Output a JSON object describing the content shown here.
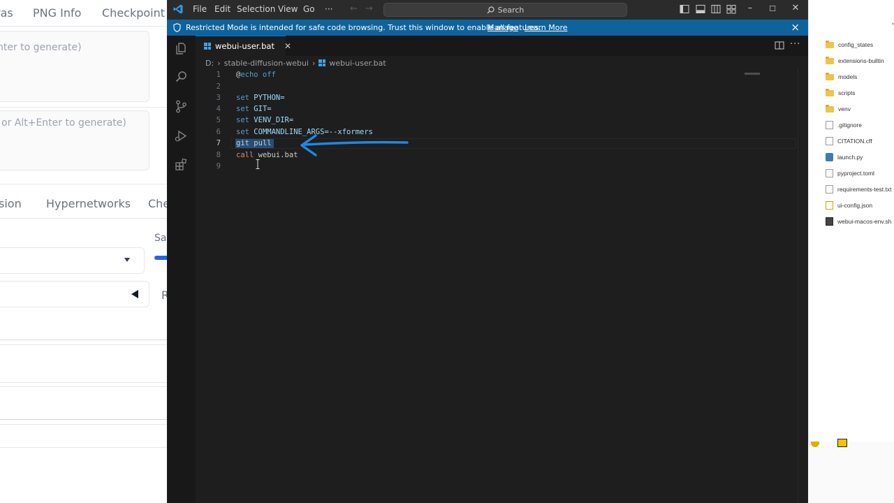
{
  "web_ui": {
    "tabs": [
      "ras",
      "PNG Info",
      "Checkpoint M"
    ],
    "prompt_placeholder": "nter to generate)",
    "negative_placeholder": "or Alt+Enter to generate)",
    "subtabs": [
      "sion",
      "Hypernetworks",
      "Che"
    ],
    "sa_label": "Sa",
    "r_label": "R"
  },
  "explorer": {
    "items": [
      {
        "name": "config_states",
        "icon": "folder"
      },
      {
        "name": "extensions-builtin",
        "icon": "folder"
      },
      {
        "name": "models",
        "icon": "folder"
      },
      {
        "name": "scripts",
        "icon": "folder"
      },
      {
        "name": "venv",
        "icon": "folder"
      },
      {
        "name": ".gitignore",
        "icon": "file"
      },
      {
        "name": "CITATION.cff",
        "icon": "cff"
      },
      {
        "name": "launch.py",
        "icon": "py"
      },
      {
        "name": "pyproject.toml",
        "icon": "file"
      },
      {
        "name": "requirements-test.txt",
        "icon": "file"
      },
      {
        "name": "ui-config.json",
        "icon": "json"
      },
      {
        "name": "webui-macos-env.sh",
        "icon": "sh"
      }
    ]
  },
  "vscode": {
    "menu": [
      "File",
      "Edit",
      "Selection",
      "View",
      "Go",
      "···"
    ],
    "search_label": "Search",
    "banner": {
      "text": "Restricted Mode is intended for safe code browsing. Trust this window to enable all features.",
      "manage": "Manage",
      "learn_more": "Learn More"
    },
    "tab": {
      "filename": "webui-user.bat",
      "close": "✕"
    },
    "breadcrumb": [
      "D:",
      "stable-diffusion-webui",
      "webui-user.bat"
    ],
    "line_numbers": [
      "1",
      "2",
      "3",
      "4",
      "5",
      "6",
      "7",
      "8",
      "9"
    ],
    "active_line": "7",
    "code": {
      "l1_at": "@",
      "l1_rest": "echo off",
      "set_kw": "set",
      "l3_var": "PYTHON=",
      "l4_var": "GIT=",
      "l5_var": "VENV_DIR=",
      "l6_var": "COMMANDLINE_ARGS=--xformers",
      "l7": "git pull",
      "l8_kw": "call",
      "l8_rest": " webui.bat"
    },
    "colors": {
      "accent": "#0078d4",
      "banner": "#0e639c",
      "annotation_arrow": "#1e88e5"
    }
  }
}
